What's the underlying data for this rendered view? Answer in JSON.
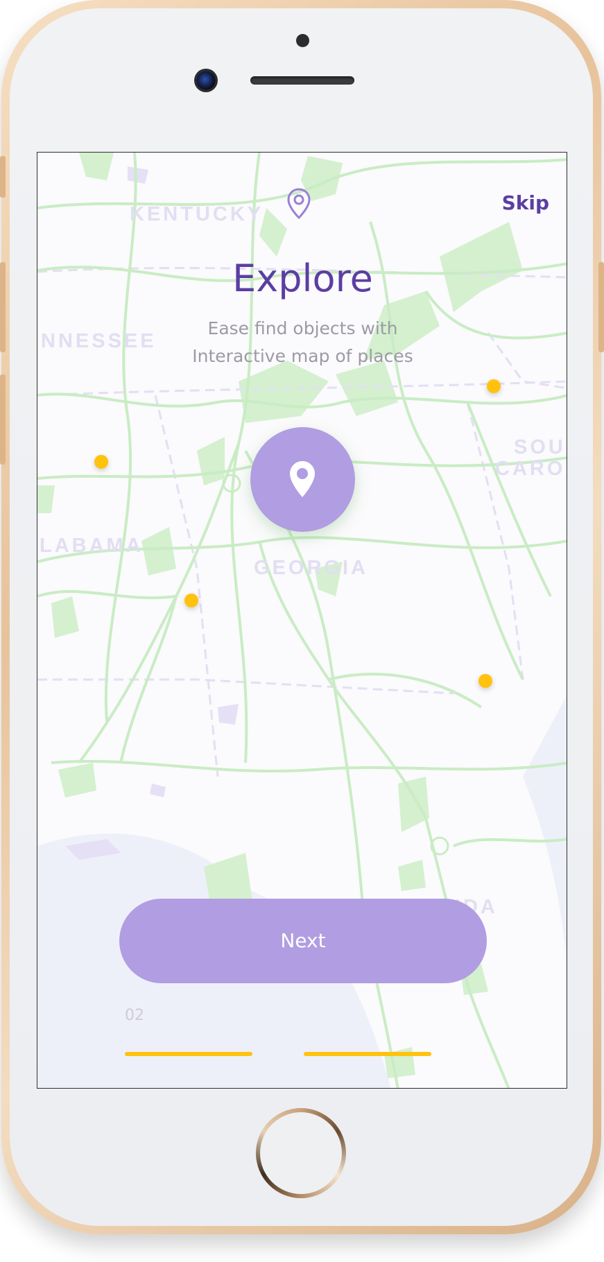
{
  "map": {
    "labels": [
      "KENTUCKY",
      "NNESSEE",
      "LABAMA",
      "GEORGIA",
      "SOU",
      "CARO",
      "FLORIDA"
    ]
  },
  "header": {
    "skip_label": "Skip"
  },
  "onboarding": {
    "title": "Explore",
    "subtitle_lines": [
      "Ease find objects with",
      "Interactive map of places"
    ],
    "next_label": "Next",
    "page_number": "02",
    "progress_segments": 2
  },
  "colors": {
    "accent": "#5b3ea3",
    "button": "#b19de2",
    "marker": "#ffc20e",
    "road": "#c9ecc4"
  },
  "icons": {
    "top": "location-pin-outline-icon",
    "center": "location-pin-icon"
  }
}
